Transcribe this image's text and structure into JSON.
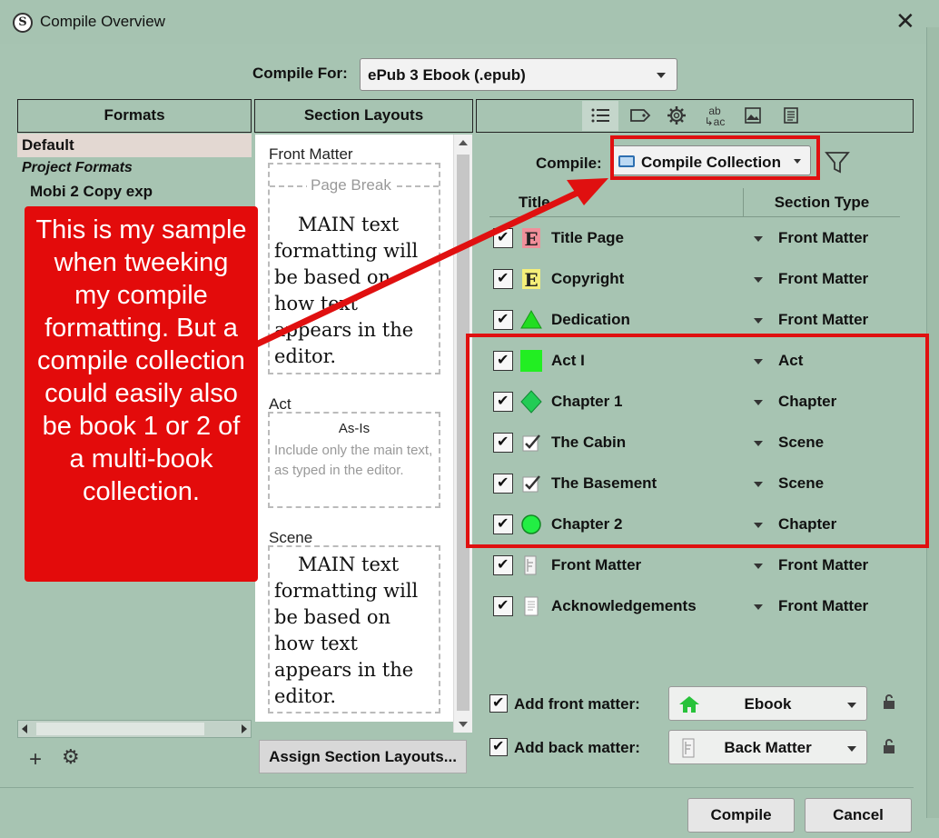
{
  "window": {
    "title": "Compile Overview",
    "app_icon_letter": "S",
    "close_glyph": "✕"
  },
  "compile_for": {
    "label": "Compile For:",
    "value": "ePub 3 Ebook (.epub)"
  },
  "formats": {
    "header": "Formats",
    "default_item": "Default",
    "project_group": "Project Formats",
    "items": [
      "Mobi 2 Copy exp"
    ],
    "add_glyph": "+",
    "gear_glyph": "⚙"
  },
  "section_layouts": {
    "header": "Section Layouts",
    "assign_button": "Assign Section Layouts...",
    "groups": [
      {
        "label": "Front Matter",
        "page_break": "Page Break",
        "preview_text": "MAIN text formatting will be based on how text appears in the editor."
      },
      {
        "label": "Act",
        "preview_title": "As-Is",
        "preview_desc": "Include only the main text, as typed in the editor."
      },
      {
        "label": "Scene",
        "preview_text": "MAIN text formatting will be based on how text appears in the editor."
      }
    ]
  },
  "toolbar": {
    "tools": [
      "contents-icon",
      "metadata-tag-icon",
      "options-gear-icon",
      "replacements-icon",
      "cover-image-icon",
      "layout-page-icon"
    ]
  },
  "compile": {
    "label": "Compile:",
    "collection": "Compile Collection",
    "columns": {
      "title": "Title",
      "section_type": "Section Type"
    },
    "rows": [
      {
        "title": "Title Page",
        "type": "Front Matter",
        "icon": "ebook-e-red-icon"
      },
      {
        "title": "Copyright",
        "type": "Front Matter",
        "icon": "ebook-e-yellow-icon"
      },
      {
        "title": "Dedication",
        "type": "Front Matter",
        "icon": "green-triangle-icon"
      },
      {
        "title": "Act I",
        "type": "Act",
        "icon": "green-square-icon"
      },
      {
        "title": "Chapter 1",
        "type": "Chapter",
        "icon": "green-diamond-icon"
      },
      {
        "title": "The Cabin",
        "type": "Scene",
        "icon": "checkmark-icon"
      },
      {
        "title": "The Basement",
        "type": "Scene",
        "icon": "checkmark-icon"
      },
      {
        "title": "Chapter 2",
        "type": "Chapter",
        "icon": "green-circle-icon"
      },
      {
        "title": "Front Matter",
        "type": "Front Matter",
        "icon": "folder-page-icon"
      },
      {
        "title": "Acknowledgements",
        "type": "Front Matter",
        "icon": "document-icon"
      }
    ]
  },
  "matter": {
    "front_label": "Add front matter:",
    "front_value": "Ebook",
    "back_label": "Add back matter:",
    "back_value": "Back Matter"
  },
  "buttons": {
    "compile": "Compile",
    "cancel": "Cancel"
  },
  "annotation": {
    "callout_text": "This is my sample when tweeking my compile formatting. But a compile collection could easily also be book 1 or 2 of a multi-book collection.",
    "color": "#e30b0b"
  },
  "colors": {
    "background": "#a7c4b2",
    "accent_red": "#e01010",
    "green": "#22dd22"
  }
}
